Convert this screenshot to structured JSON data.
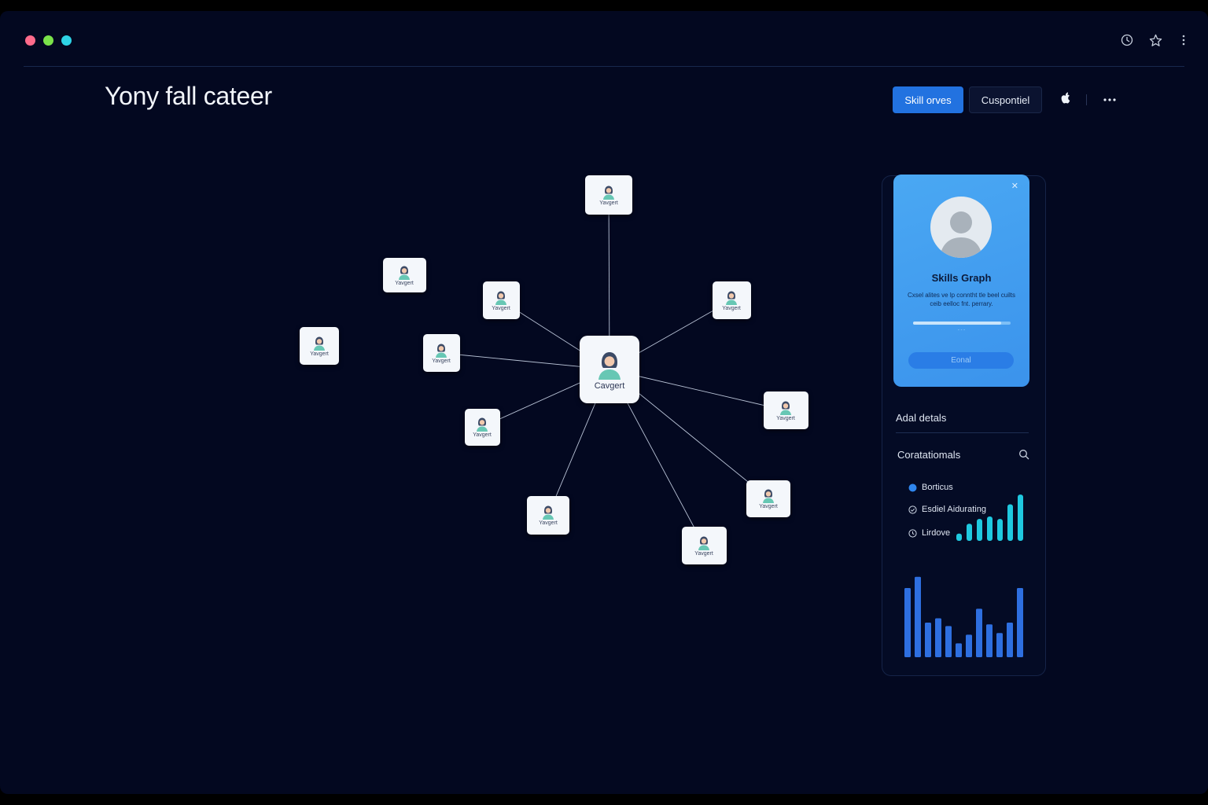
{
  "window": {
    "controls": [
      "close",
      "minimize",
      "zoom"
    ]
  },
  "toolbar_icons": [
    "history-icon",
    "star-icon",
    "kebab-menu-icon"
  ],
  "header": {
    "title": "Yony fall cateer",
    "primary_button": "Skill orves",
    "secondary_button": "Cuspontiel",
    "apple_icon": "apple-icon",
    "more_icon": "more-icon"
  },
  "graph": {
    "center": {
      "label": "Cavgert"
    },
    "nodes": [
      {
        "label": "Yavgert"
      },
      {
        "label": "Yavgert"
      },
      {
        "label": "Yavgert"
      },
      {
        "label": "Yavgert"
      },
      {
        "label": "Yavgert"
      },
      {
        "label": "Yavgert"
      },
      {
        "label": "Yavgert"
      },
      {
        "label": "Yavgert"
      },
      {
        "label": "Yavgert"
      },
      {
        "label": "Yavgert"
      },
      {
        "label": "Yavgert"
      }
    ]
  },
  "card": {
    "title": "Skills Graph",
    "description": "Cxsel alites ve lp conntht tle beel cuilts ceib eelloc fnt. perrary.",
    "progress": 0.9,
    "meta": "- - -",
    "button": "Eonal"
  },
  "details": {
    "label": "Adal detals"
  },
  "correlations": {
    "label": "Coratatiomals",
    "legend": [
      {
        "label": "Borticus",
        "icon": "filled-dot-icon",
        "color": "#2f86ee"
      },
      {
        "label": "Esdiel Aidurating",
        "icon": "check-circle-icon",
        "color": "#cfd8e6"
      },
      {
        "label": "Lirdove",
        "icon": "clock-icon",
        "color": "#cfd8e6"
      }
    ],
    "mini_bars": [
      0.15,
      0.35,
      0.45,
      0.5,
      0.45,
      0.75,
      0.95,
      0.8
    ],
    "big_bars": [
      0.8,
      0.93,
      0.4,
      0.45,
      0.36,
      0.16,
      0.26,
      0.56,
      0.38,
      0.28,
      0.4,
      0.8
    ]
  },
  "colors": {
    "background": "#030820",
    "accent": "#2272e0",
    "card": "#4aa8f3",
    "mini_bar": "#1fc9e0",
    "big_bar": "#2e6fe0"
  }
}
